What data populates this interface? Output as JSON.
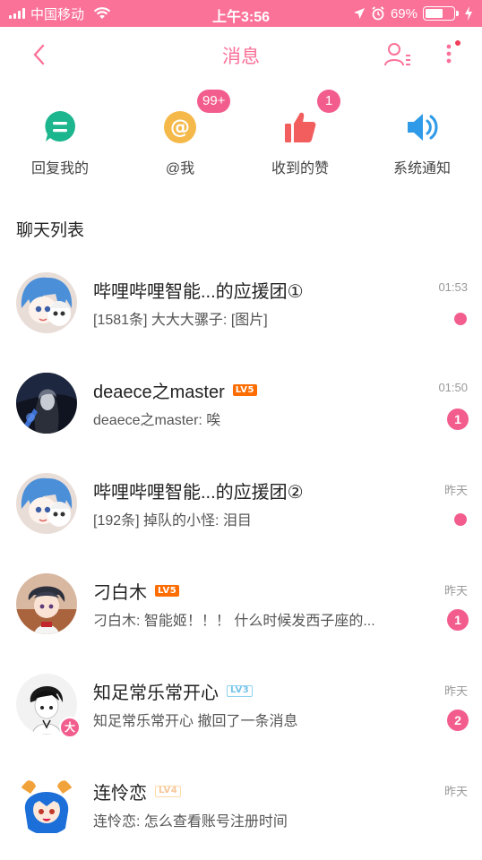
{
  "status_bar": {
    "carrier": "中国移动",
    "time": "上午3:56",
    "battery_percent": "69%",
    "battery_level": 0.69,
    "icons": [
      "signal-icon",
      "wifi-icon",
      "location-icon",
      "alarm-icon",
      "battery-icon",
      "charging-icon"
    ]
  },
  "header": {
    "title": "消息",
    "back_icon": "chevron-left-icon",
    "contacts_icon": "contacts-icon",
    "more_icon": "more-vertical-icon",
    "accent_color": "#fb7299"
  },
  "quick_actions": [
    {
      "label": "回复我的",
      "icon": "reply-chat-icon",
      "badge": null,
      "color": "#1bb58e"
    },
    {
      "label": "@我",
      "icon": "at-icon",
      "badge": "99+",
      "color": "#f5b94a"
    },
    {
      "label": "收到的赞",
      "icon": "thumbs-up-icon",
      "badge": "1",
      "color": "#f25d5d"
    },
    {
      "label": "系统通知",
      "icon": "speaker-icon",
      "badge": null,
      "color": "#2f9be8"
    }
  ],
  "section_title": "聊天列表",
  "chats": [
    {
      "name": "哔哩哔哩智能...的应援团①",
      "level": null,
      "preview": "[1581条]  大大大骡子:  [图片]",
      "time": "01:53",
      "unread": "dot"
    },
    {
      "name": "deaece之master",
      "level": "LV5",
      "preview": "deaece之master:  唉",
      "time": "01:50",
      "unread": "1"
    },
    {
      "name": "哔哩哔哩智能...的应援团②",
      "level": null,
      "preview": "[192条]  掉队的小怪:  泪目",
      "time": "昨天",
      "unread": "dot"
    },
    {
      "name": "刁白木",
      "level": "LV5",
      "preview": "刁白木:  智能姬！！！  什么时候发西子座的...",
      "time": "昨天",
      "unread": "1"
    },
    {
      "name": "知足常乐常开心",
      "level": "LV3",
      "preview": "知足常乐常开心  撤回了一条消息",
      "time": "昨天",
      "unread": "2",
      "avatar_badge": "大"
    },
    {
      "name": "连怜恋",
      "level": "LV4",
      "preview": "连怜恋:  怎么查看账号注册时间",
      "time": "昨天",
      "unread": null
    }
  ]
}
